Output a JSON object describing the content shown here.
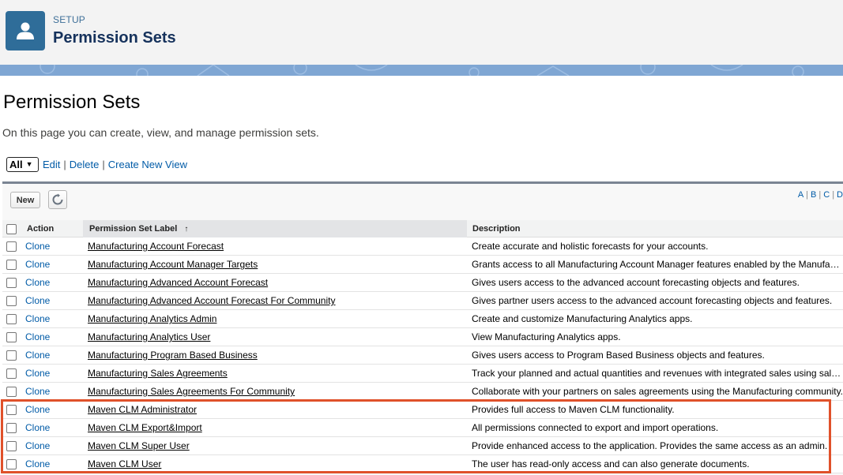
{
  "header": {
    "eyebrow": "SETUP",
    "title": "Permission Sets",
    "icon": "user-icon"
  },
  "page": {
    "title": "Permission Sets",
    "description": "On this page you can create, view, and manage permission sets."
  },
  "view": {
    "selected": "All",
    "links": {
      "edit": "Edit",
      "delete": "Delete",
      "create": "Create New View"
    }
  },
  "toolbar": {
    "new_label": "New",
    "refresh_icon": "refresh-icon",
    "alpha": [
      "A",
      "B",
      "C",
      "D"
    ]
  },
  "table": {
    "columns": {
      "action": "Action",
      "label": "Permission Set Label",
      "sort_indicator": "↑",
      "description": "Description"
    },
    "rows": [
      {
        "action": "Clone",
        "label": "Manufacturing Account Forecast",
        "description": "Create accurate and holistic forecasts for your accounts."
      },
      {
        "action": "Clone",
        "label": "Manufacturing Account Manager Targets",
        "description": "Grants access to all Manufacturing Account Manager features enabled by the Manufacturing Cloud license."
      },
      {
        "action": "Clone",
        "label": "Manufacturing Advanced Account Forecast",
        "description": "Gives users access to the advanced account forecasting objects and features."
      },
      {
        "action": "Clone",
        "label": "Manufacturing Advanced Account Forecast For Community",
        "description": "Gives partner users access to the advanced account forecasting objects and features."
      },
      {
        "action": "Clone",
        "label": "Manufacturing Analytics Admin",
        "description": "Create and customize Manufacturing Analytics apps."
      },
      {
        "action": "Clone",
        "label": "Manufacturing Analytics User",
        "description": "View Manufacturing Analytics apps."
      },
      {
        "action": "Clone",
        "label": "Manufacturing Program Based Business",
        "description": "Gives users access to Program Based Business objects and features."
      },
      {
        "action": "Clone",
        "label": "Manufacturing Sales Agreements",
        "description": "Track your planned and actual quantities and revenues with integrated sales using sales agreements."
      },
      {
        "action": "Clone",
        "label": "Manufacturing Sales Agreements For Community",
        "description": "Collaborate with your partners on sales agreements using the Manufacturing community."
      },
      {
        "action": "Clone",
        "label": "Maven CLM Administrator",
        "description": "Provides full access to Maven CLM functionality."
      },
      {
        "action": "Clone",
        "label": "Maven CLM Export&Import",
        "description": "All permissions connected to export and import operations."
      },
      {
        "action": "Clone",
        "label": "Maven CLM Super User",
        "description": "Provide enhanced access to the application. Provides the same access as an admin."
      },
      {
        "action": "Clone",
        "label": "Maven CLM User",
        "description": "The user has read-only access and can also generate documents."
      }
    ]
  },
  "colors": {
    "accent": "#2f6d99",
    "link": "#015ba7",
    "highlight": "#e0512a"
  }
}
